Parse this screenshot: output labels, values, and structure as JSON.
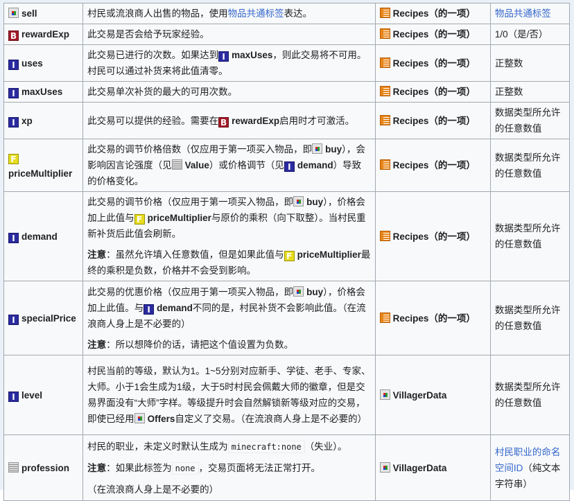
{
  "rows": [
    {
      "icon": "item",
      "name": "sell",
      "desc": [
        [
          {
            "t": "村民或流浪商人出售的物品，使用"
          },
          {
            "t": "物品共通标签",
            "k": "link"
          },
          {
            "t": "表达。"
          }
        ]
      ],
      "parent_icon": "list",
      "parent": "Recipes（的一项）",
      "value": "物品共通标签",
      "value_link": true
    },
    {
      "icon": "B",
      "name": "rewardExp",
      "desc": [
        [
          {
            "t": "此交易是否会给予玩家经验。"
          }
        ]
      ],
      "parent_icon": "list",
      "parent": "Recipes（的一项）",
      "value": "1/0（是/否）"
    },
    {
      "icon": "I",
      "name": "uses",
      "desc": [
        [
          {
            "t": "此交易已进行的次数。如果达到"
          },
          {
            "t": "maxUses",
            "k": "b",
            "i": "I"
          },
          {
            "t": "，则此交易将不可用。村民可以通过补货来将此值清零。"
          }
        ]
      ],
      "parent_icon": "list",
      "parent": "Recipes（的一项）",
      "value": "正整数"
    },
    {
      "icon": "I",
      "name": "maxUses",
      "desc": [
        [
          {
            "t": "此交易单次补货的最大的可用次数。"
          }
        ]
      ],
      "parent_icon": "list",
      "parent": "Recipes（的一项）",
      "value": "正整数"
    },
    {
      "icon": "I",
      "name": "xp",
      "desc": [
        [
          {
            "t": "此交易可以提供的经验。需要在"
          },
          {
            "t": "rewardExp",
            "k": "b",
            "i": "B"
          },
          {
            "t": "启用时才可激活。"
          }
        ]
      ],
      "parent_icon": "list",
      "parent": "Recipes（的一项）",
      "value": "数据类型所允许的任意数值"
    },
    {
      "icon": "F",
      "name": "priceMultiplier",
      "desc": [
        [
          {
            "t": "此交易的调节价格倍数（仅应用于第一项买入物品，即"
          },
          {
            "t": "buy",
            "k": "b",
            "i": "item"
          },
          {
            "t": "），会影响因言论强度（见"
          },
          {
            "t": "Value",
            "k": "b",
            "i": "str"
          },
          {
            "t": "）或价格调节（见"
          },
          {
            "t": "demand",
            "k": "b",
            "i": "I"
          },
          {
            "t": "）导致的价格变化。"
          }
        ]
      ],
      "parent_icon": "list",
      "parent": "Recipes（的一项）",
      "value": "数据类型所允许的任意数值",
      "stack": true
    },
    {
      "icon": "I",
      "name": "demand",
      "desc": [
        [
          {
            "t": "此交易的调节价格（仅应用于第一项买入物品，即"
          },
          {
            "t": "buy",
            "k": "b",
            "i": "item"
          },
          {
            "t": "），价格会加上此值与"
          },
          {
            "t": "priceMultiplier",
            "k": "b",
            "i": "F"
          },
          {
            "t": "与原价的乘积（向下取整）。当村民重新补货后此值会刷新。"
          }
        ],
        [
          {
            "t": "注意",
            "k": "b"
          },
          {
            "t": "：虽然允许填入任意数值，但是如果此值与"
          },
          {
            "t": "priceMultiplier",
            "k": "b",
            "i": "F"
          },
          {
            "t": "最终的乘积是负数，价格并不会受到影响。"
          }
        ]
      ],
      "parent_icon": "list",
      "parent": "Recipes（的一项）",
      "value": "数据类型所允许的任意数值"
    },
    {
      "icon": "I",
      "name": "specialPrice",
      "desc": [
        [
          {
            "t": "此交易的优惠价格（仅应用于第一项买入物品，即"
          },
          {
            "t": "buy",
            "k": "b",
            "i": "item"
          },
          {
            "t": "），价格会加上此值。与"
          },
          {
            "t": "demand",
            "k": "b",
            "i": "I"
          },
          {
            "t": "不同的是，村民补货不会影响此值。（在流浪商人身上是不必要的）"
          }
        ],
        [
          {
            "t": "注意",
            "k": "b"
          },
          {
            "t": "：所以想降价的话，请把这个值设置为负数。"
          }
        ]
      ],
      "parent_icon": "list",
      "parent": "Recipes（的一项）",
      "value": "数据类型所允许的任意数值"
    },
    {
      "icon": "I",
      "name": "level",
      "desc": [
        [
          {
            "t": "村民当前的等级，默认为1。1~5分别对应新手、学徒、老手、专家、大师。小于1会生成为1级，大于5时村民会佩戴大师的徽章，但是交易界面没有“大师”字样。等级提升时会自然解锁新等级对应的交易，即使已经用"
          },
          {
            "t": "Offers",
            "k": "b",
            "i": "item"
          },
          {
            "t": "自定义了交易。（在流浪商人身上是不必要的）"
          }
        ]
      ],
      "parent_icon": "item",
      "parent": "VillagerData",
      "value": "数据类型所允许的任意数值"
    },
    {
      "icon": "str",
      "name": "profession",
      "desc": [
        [
          {
            "t": "村民的职业，未定义时默认生成为"
          },
          {
            "t": "minecraft:none",
            "k": "code"
          },
          {
            "t": "（失业）。"
          }
        ],
        [
          {
            "t": "注意",
            "k": "b"
          },
          {
            "t": "：如果此标签为"
          },
          {
            "t": "none",
            "k": "code"
          },
          {
            "t": "，交易页面将无法正常打开。"
          }
        ],
        [
          {
            "t": "（在流浪商人身上是不必要的）"
          }
        ]
      ],
      "parent_icon": "item",
      "parent": "VillagerData",
      "value": "村民职业的命名空间ID（纯文本字符串）",
      "value_link_part": "村民职业的命名空间ID"
    }
  ]
}
